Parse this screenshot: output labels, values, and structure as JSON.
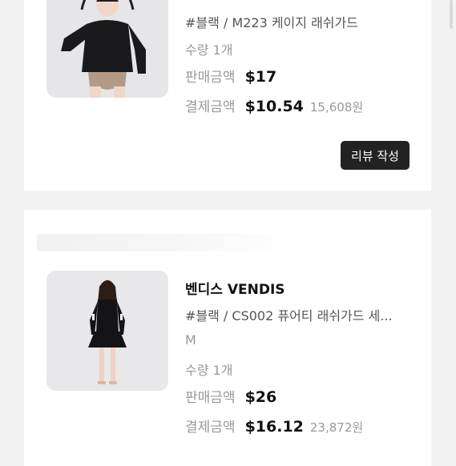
{
  "item1": {
    "option": "#블랙 / M223 케이지 래쉬가드",
    "quantity": "수량 1개",
    "sale_label": "판매금액",
    "sale_price": "$17",
    "paid_label": "결제금액",
    "paid_price": "$10.54",
    "paid_krw": "15,608원",
    "review_button": "리뷰 작성"
  },
  "item2": {
    "brand": "벤디스 VENDIS",
    "option": "#블랙 / CS002 퓨어티 래쉬가드 세...",
    "size": "M",
    "quantity": "수량 1개",
    "sale_label": "판매금액",
    "sale_price": "$26",
    "paid_label": "결제금액",
    "paid_price": "$16.12",
    "paid_krw": "23,872원"
  }
}
